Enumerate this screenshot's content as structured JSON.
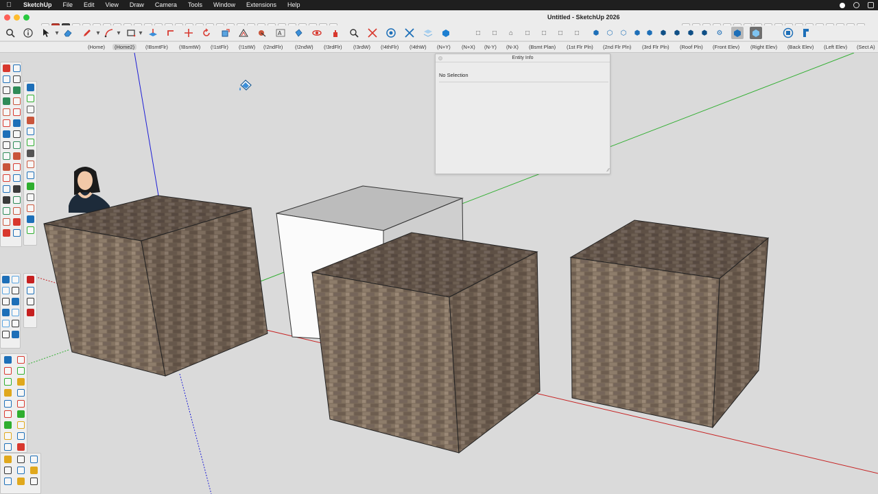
{
  "app": {
    "name": "SketchUp",
    "window_title": "Untitled - SketchUp 2026"
  },
  "menu": [
    "File",
    "Edit",
    "View",
    "Draw",
    "Camera",
    "Tools",
    "Window",
    "Extensions",
    "Help"
  ],
  "scenes": [
    {
      "label": "(Home)",
      "active": false
    },
    {
      "label": "(Home2)",
      "active": true
    },
    {
      "label": "(!BsmtFlr)",
      "active": false
    },
    {
      "label": "(!BsmtW)",
      "active": false
    },
    {
      "label": "(!1stFlr)",
      "active": false
    },
    {
      "label": "(!1stW)",
      "active": false
    },
    {
      "label": "(!2ndFlr)",
      "active": false
    },
    {
      "label": "(!2ndW)",
      "active": false
    },
    {
      "label": "(!3rdFlr)",
      "active": false
    },
    {
      "label": "(!3rdW)",
      "active": false
    },
    {
      "label": "(!4thFlr)",
      "active": false
    },
    {
      "label": "(!4thW)",
      "active": false
    },
    {
      "label": "(N+Y)",
      "active": false
    },
    {
      "label": "(N+X)",
      "active": false
    },
    {
      "label": "(N-Y)",
      "active": false
    },
    {
      "label": "(N-X)",
      "active": false
    },
    {
      "label": "(Bsmt Plan)",
      "active": false
    },
    {
      "label": "(1st Flr Pln)",
      "active": false
    },
    {
      "label": "(2nd Flr Pln)",
      "active": false
    },
    {
      "label": "(3rd Flr Pln)",
      "active": false
    },
    {
      "label": "(Roof Pln)",
      "active": false
    },
    {
      "label": "(Front Elev)",
      "active": false
    },
    {
      "label": "(Right Elev)",
      "active": false
    },
    {
      "label": "(Back Elev)",
      "active": false
    },
    {
      "label": "(Left Elev)",
      "active": false
    },
    {
      "label": "(Sect A)",
      "active": false
    }
  ],
  "entity_info": {
    "title": "Entity Info",
    "selection": "No Selection"
  },
  "icons": {
    "select_tool": "select-arrow-icon",
    "paint_bucket": "paint-bucket-icon",
    "search": "search-icon",
    "info": "info-icon",
    "eraser": "eraser-icon",
    "pencil": "pencil-icon"
  },
  "colors": {
    "menubar": "#1f1f1f",
    "chrome": "#ececec",
    "viewport": "#dadada",
    "axis_red": "#c62020",
    "axis_green": "#2fae2f",
    "axis_blue": "#1c1cd6",
    "brick": "#7a6a5a",
    "brick_dark": "#5b4d40",
    "brick_light": "#9d8c7a"
  },
  "model": {
    "cubes": [
      {
        "material": "brick"
      },
      {
        "material": "default-white"
      },
      {
        "material": "brick"
      },
      {
        "material": "brick"
      }
    ]
  }
}
